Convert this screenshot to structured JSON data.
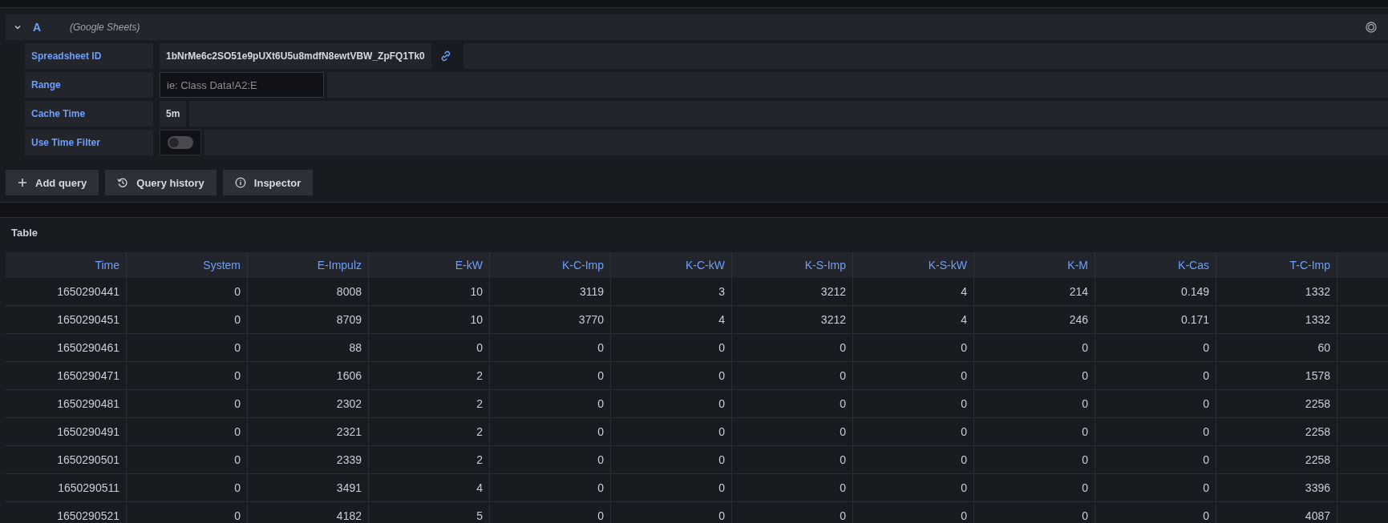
{
  "query": {
    "ref_id": "A",
    "datasource": "(Google Sheets)",
    "expanded": true,
    "fields": [
      {
        "kind": "text",
        "label": "Spreadsheet ID",
        "value": "1bNrMe6c2SO51e9pUXt6U5u8mdfN8ewtVBW_ZpFQ1Tk0",
        "link": true
      },
      {
        "kind": "input",
        "label": "Range",
        "placeholder": "ie: Class Data!A2:E"
      },
      {
        "kind": "text",
        "label": "Cache Time",
        "value": "5m",
        "link": false
      },
      {
        "kind": "switch",
        "label": "Use Time Filter",
        "on": false
      }
    ]
  },
  "buttons": [
    {
      "kind": "add",
      "label": "Add query"
    },
    {
      "kind": "history",
      "label": "Query history"
    },
    {
      "kind": "info",
      "label": "Inspector"
    }
  ],
  "table": {
    "title": "Table",
    "columns": [
      "Time",
      "System",
      "E-Impulz",
      "E-kW",
      "K-C-Imp",
      "K-C-kW",
      "K-S-Imp",
      "K-S-kW",
      "K-M",
      "K-Cas",
      "T-C-Imp"
    ],
    "rows": [
      [
        "1650290441",
        "0",
        "8008",
        "10",
        "3119",
        "3",
        "3212",
        "4",
        "214",
        "0.149",
        "1332"
      ],
      [
        "1650290451",
        "0",
        "8709",
        "10",
        "3770",
        "4",
        "3212",
        "4",
        "246",
        "0.171",
        "1332"
      ],
      [
        "1650290461",
        "0",
        "88",
        "0",
        "0",
        "0",
        "0",
        "0",
        "0",
        "0",
        "60"
      ],
      [
        "1650290471",
        "0",
        "1606",
        "2",
        "0",
        "0",
        "0",
        "0",
        "0",
        "0",
        "1578"
      ],
      [
        "1650290481",
        "0",
        "2302",
        "2",
        "0",
        "0",
        "0",
        "0",
        "0",
        "0",
        "2258"
      ],
      [
        "1650290491",
        "0",
        "2321",
        "2",
        "0",
        "0",
        "0",
        "0",
        "0",
        "0",
        "2258"
      ],
      [
        "1650290501",
        "0",
        "2339",
        "2",
        "0",
        "0",
        "0",
        "0",
        "0",
        "0",
        "2258"
      ],
      [
        "1650290511",
        "0",
        "3491",
        "4",
        "0",
        "0",
        "0",
        "0",
        "0",
        "0",
        "3396"
      ],
      [
        "1650290521",
        "0",
        "4182",
        "5",
        "0",
        "0",
        "0",
        "0",
        "0",
        "0",
        "4087"
      ]
    ]
  }
}
